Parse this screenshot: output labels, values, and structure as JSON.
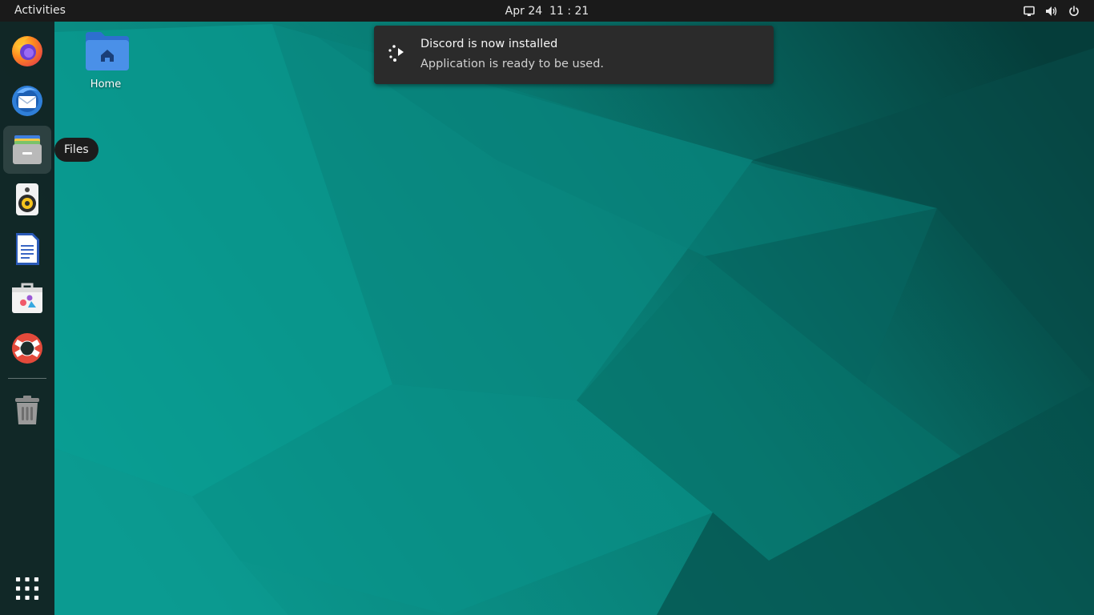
{
  "topbar": {
    "activities_label": "Activities",
    "clock_text": "Apr 24  11 : 21",
    "status_icons": [
      "screen-icon",
      "volume-icon",
      "power-icon"
    ]
  },
  "dock": {
    "items": [
      {
        "name": "Firefox",
        "icon": "firefox-icon"
      },
      {
        "name": "Thunderbird",
        "icon": "thunderbird-icon"
      },
      {
        "name": "Files",
        "icon": "files-icon",
        "active": true
      },
      {
        "name": "Rhythmbox",
        "icon": "rhythmbox-icon"
      },
      {
        "name": "LibreOffice Writer",
        "icon": "writer-icon"
      },
      {
        "name": "Software",
        "icon": "software-icon"
      },
      {
        "name": "Help",
        "icon": "help-icon"
      },
      {
        "name": "Trash",
        "icon": "trash-icon"
      }
    ],
    "app_grid_icon": "app-grid-icon"
  },
  "tooltip": {
    "text": "Files"
  },
  "desktop": {
    "icons": [
      {
        "label": "Home",
        "icon": "home-folder-icon"
      }
    ]
  },
  "notification": {
    "title": "Discord is now installed",
    "body": "Application is ready to be used.",
    "icon": "progress-dots-icon"
  },
  "colors": {
    "topbar_bg": "#1a1a1a",
    "wallpaper_teal": "#0a8f86",
    "wallpaper_dark": "#06403d",
    "notification_bg": "#2b2b2b"
  }
}
